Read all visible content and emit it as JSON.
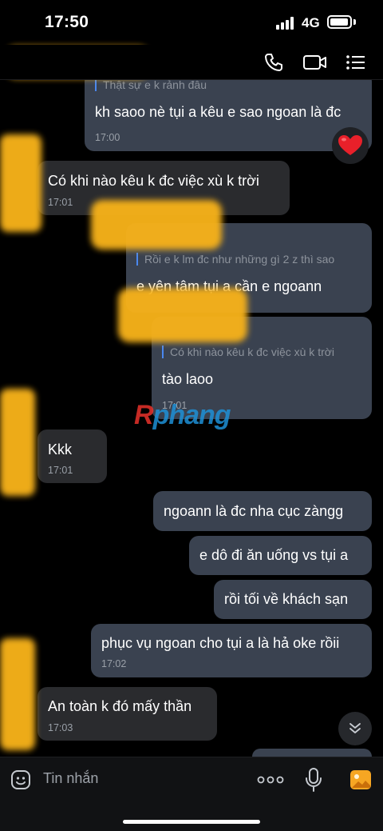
{
  "status_bar": {
    "time": "17:50",
    "network": "4G"
  },
  "header": {
    "call_icon": "phone-icon",
    "video_icon": "video-call-icon",
    "menu_icon": "list-menu-icon"
  },
  "messages": [
    {
      "side": "mine",
      "quote": "Thật sự e k rảnh đâu",
      "text": "kh saoo nè tụi a kêu e sao ngoan là đc",
      "time": "17:00",
      "reaction": "heart"
    },
    {
      "side": "theirs",
      "text": "Có khi nào kêu k đc việc xù k trời",
      "time": "17:01"
    },
    {
      "side": "mine",
      "quote": "Rồi e k lm đc như những gì 2 z thì sao",
      "text": "e yên tâm tụi a cần e ngoann"
    },
    {
      "side": "mine",
      "quote": "Có khi nào kêu k đc việc xù k trời",
      "text": "tào laoo",
      "time": "17:01"
    },
    {
      "side": "theirs",
      "text": "Kkk",
      "time": "17:01"
    },
    {
      "side": "mine",
      "text": "ngoann là đc nha cục zàngg"
    },
    {
      "side": "mine",
      "text": "e dô đi ăn uống vs tụi a"
    },
    {
      "side": "mine",
      "text": "rồi tối về khách sạn"
    },
    {
      "side": "mine",
      "text": "phục vụ ngoan cho tụi a là hả oke rồii",
      "time": "17:02"
    },
    {
      "side": "theirs",
      "text": "An toàn k đó mấy thần",
      "time": "17:03"
    }
  ],
  "watermark": {
    "first": "R",
    "rest": "phang"
  },
  "input": {
    "placeholder": "Tin nhắn"
  },
  "colors": {
    "my_bubble": "#3a4250",
    "their_bubble": "#2a2b2e",
    "quote_bar": "#4a88f0",
    "accent": "#f6a623"
  }
}
